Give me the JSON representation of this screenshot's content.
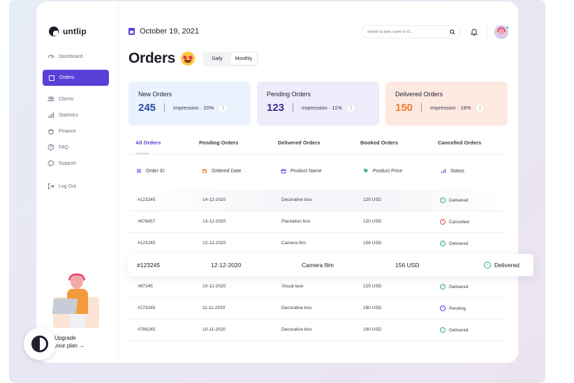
{
  "brand": {
    "name": "untlip"
  },
  "sidebar": {
    "items": [
      {
        "label": "Dashboard",
        "icon": "dashboard-icon"
      },
      {
        "label": "Orders",
        "icon": "orders-icon",
        "active": true
      },
      {
        "label": "Clients",
        "icon": "clients-icon"
      },
      {
        "label": "Statistics",
        "icon": "statistics-icon"
      },
      {
        "label": "Finance",
        "icon": "finance-icon"
      },
      {
        "label": "FAQ",
        "icon": "faq-icon"
      },
      {
        "label": "Support",
        "icon": "support-icon"
      },
      {
        "label": "Log Out",
        "icon": "logout-icon"
      }
    ],
    "upgrade": {
      "line1": "Upgrade",
      "line2": "your plan →"
    }
  },
  "header": {
    "date": "October 19, 2021",
    "search_placeholder": "Search by date, name or ID..."
  },
  "page": {
    "title": "Orders",
    "period": {
      "daily": "Daily",
      "monthly": "Monthly",
      "selected": "Monthly"
    }
  },
  "cards": [
    {
      "title": "New Orders",
      "value": "245",
      "impression": "Impression · 20%",
      "bg": "#eaf2fe",
      "value_color": "#2f4aa0"
    },
    {
      "title": "Pending Orders",
      "value": "123",
      "impression": "Impression · 11%",
      "bg": "#eeebfb",
      "value_color": "#3b2f96"
    },
    {
      "title": "Delivered Orders",
      "value": "150",
      "impression": "Impression · 18%",
      "bg": "#fde9e0",
      "value_color": "#f27a2c"
    }
  ],
  "tabs": [
    "All Orders",
    "Pending Orders",
    "Delivered Orders",
    "Booked Orders",
    "Cancelled Orders"
  ],
  "table": {
    "headers": [
      "Order ID",
      "Ordered Date",
      "Product Name",
      "Product Price",
      "Status"
    ],
    "rows": [
      {
        "id": "#123245",
        "date": "14-12-2020",
        "product": "Decorative box",
        "price": "125 USD",
        "status": "Delivered"
      },
      {
        "id": "#678457",
        "date": "13-12-2020",
        "product": "Plantation box",
        "price": "120 USD",
        "status": "Cancelled"
      },
      {
        "id": "#123245",
        "date": "12-12-2020",
        "product": "Camera film",
        "price": "156 USD",
        "status": "Delivered"
      },
      {
        "id": "#123245",
        "date": "12-12-2020",
        "product": "Camera film",
        "price": "156 USD",
        "status": "Delivered"
      },
      {
        "id": "#87245",
        "date": "10-12-2020",
        "product": "Visual lace",
        "price": "125 USD",
        "status": "Delivered"
      },
      {
        "id": "#273245",
        "date": "11-11-2020",
        "product": "Decorative box",
        "price": "180 USD",
        "status": "Pending"
      },
      {
        "id": "#789245",
        "date": "10-11-2020",
        "product": "Decorative box",
        "price": "190 USD",
        "status": "Delivered"
      }
    ]
  },
  "status_colors": {
    "Delivered": "#2fae6b",
    "Cancelled": "#e2484a",
    "Pending": "#5a3fd6"
  },
  "accent": "#5a3fd6"
}
